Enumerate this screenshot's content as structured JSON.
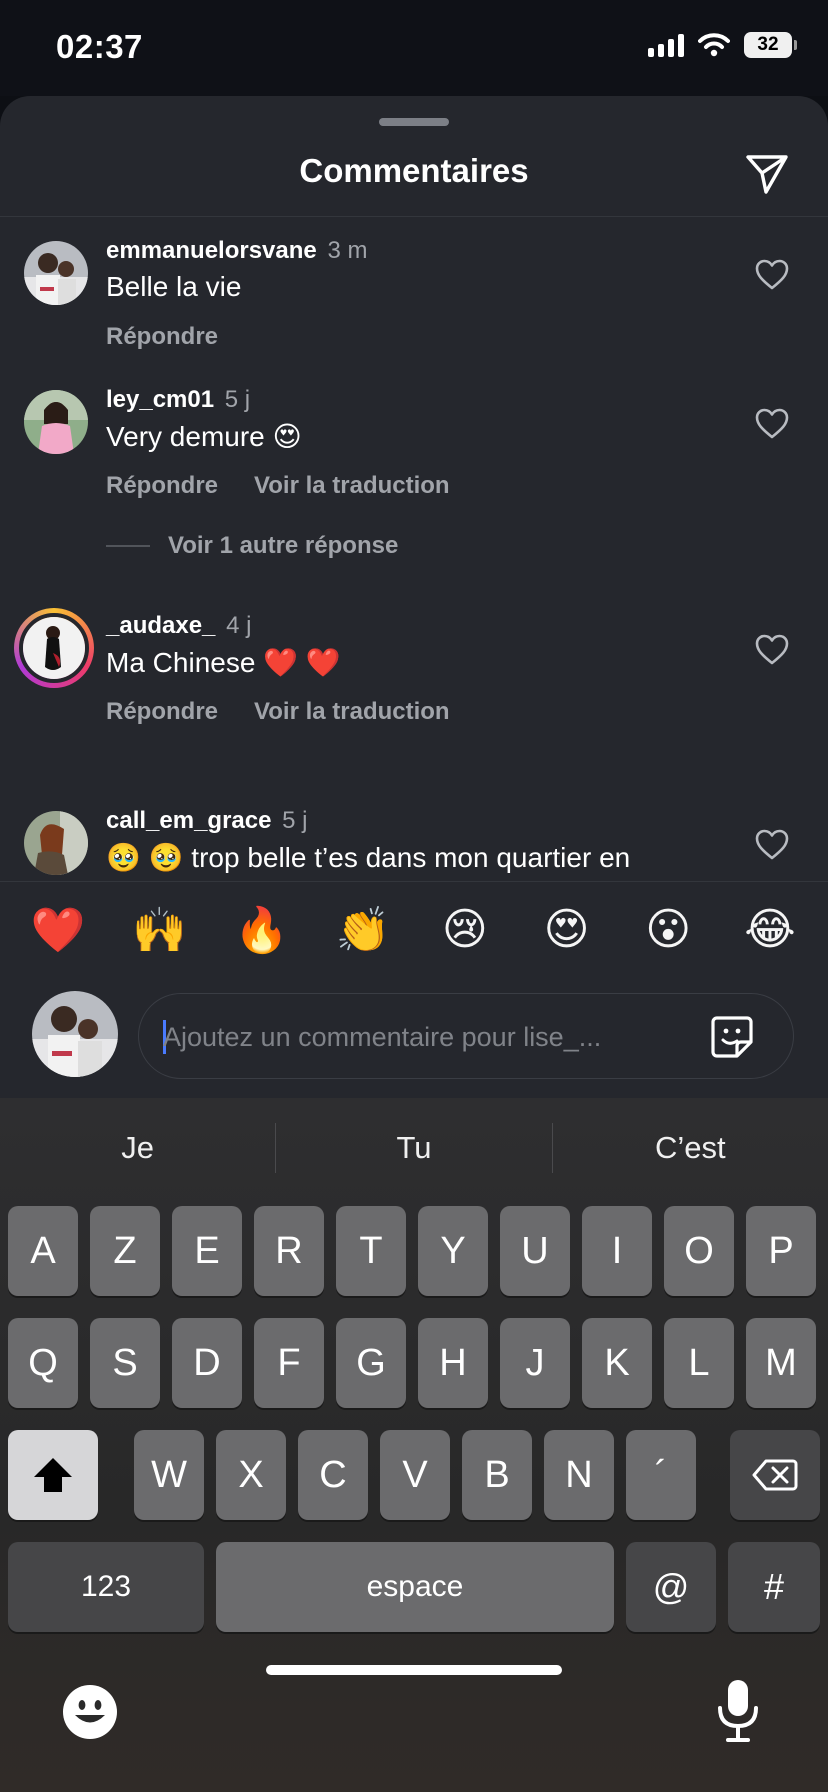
{
  "status": {
    "time": "02:37",
    "battery": "32"
  },
  "sheet": {
    "title": "Commentaires"
  },
  "comments": [
    {
      "user": "emmanuelorsvane",
      "time": "3 m",
      "text": "Belle la vie",
      "actions": [
        "Répondre"
      ]
    },
    {
      "user": "ley_cm01",
      "time": "5 j",
      "text": "Very demure 😍",
      "actions": [
        "Répondre",
        "Voir la traduction"
      ],
      "more_replies": "Voir 1 autre réponse"
    },
    {
      "user": "_audaxe_",
      "time": "4 j",
      "text": "Ma Chinese ❤️ ❤️",
      "actions": [
        "Répondre",
        "Voir la traduction"
      ]
    },
    {
      "user": "call_em_grace",
      "time": "5 j",
      "text": "🥹 🥹 trop belle t’es dans mon quartier en"
    }
  ],
  "emoji_bar": [
    "❤️",
    "🙌",
    "🔥",
    "👏",
    "😢",
    "😍",
    "😮",
    "😂"
  ],
  "composer": {
    "placeholder": "Ajoutez un commentaire pour lise_..."
  },
  "keyboard": {
    "suggestions": [
      "Je",
      "Tu",
      "C’est"
    ],
    "row1": [
      "A",
      "Z",
      "E",
      "R",
      "T",
      "Y",
      "U",
      "I",
      "O",
      "P"
    ],
    "row2": [
      "Q",
      "S",
      "D",
      "F",
      "G",
      "H",
      "J",
      "K",
      "L",
      "M"
    ],
    "row3": [
      "W",
      "X",
      "C",
      "V",
      "B",
      "N",
      "´"
    ],
    "numbers_label": "123",
    "space_label": "espace",
    "at_label": "@",
    "hash_label": "#"
  },
  "icons": {
    "share": "paper-plane-icon",
    "like": "heart-outline-icon",
    "sticker": "sticker-icon",
    "shift": "shift-arrow-icon",
    "delete": "backspace-icon",
    "emoji": "emoji-face-icon",
    "dictation": "microphone-icon"
  }
}
